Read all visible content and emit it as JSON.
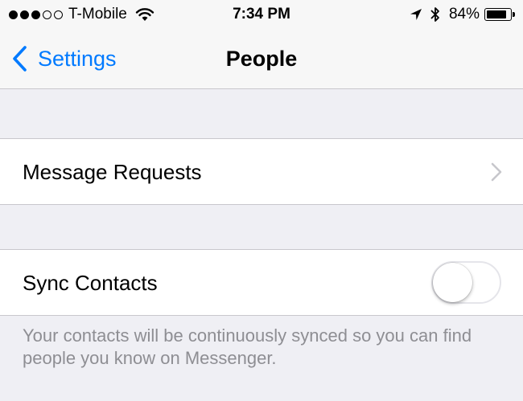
{
  "status_bar": {
    "carrier": "T-Mobile",
    "time": "7:34 PM",
    "battery_percent": "84%",
    "battery_level": 0.84,
    "signal_dots_filled": 3,
    "signal_dots_total": 5,
    "icons": [
      "wifi-icon",
      "location-icon",
      "bluetooth-icon",
      "battery-icon"
    ]
  },
  "nav": {
    "back_label": "Settings",
    "title": "People"
  },
  "rows": {
    "message_requests": {
      "label": "Message Requests"
    },
    "sync_contacts": {
      "label": "Sync Contacts",
      "toggle_on": false
    }
  },
  "footer": {
    "text": "Your contacts will be continuously synced so you can find people you know on Messenger."
  },
  "colors": {
    "accent": "#007aff",
    "background": "#efeff4",
    "secondary_text": "#8e8e93"
  }
}
